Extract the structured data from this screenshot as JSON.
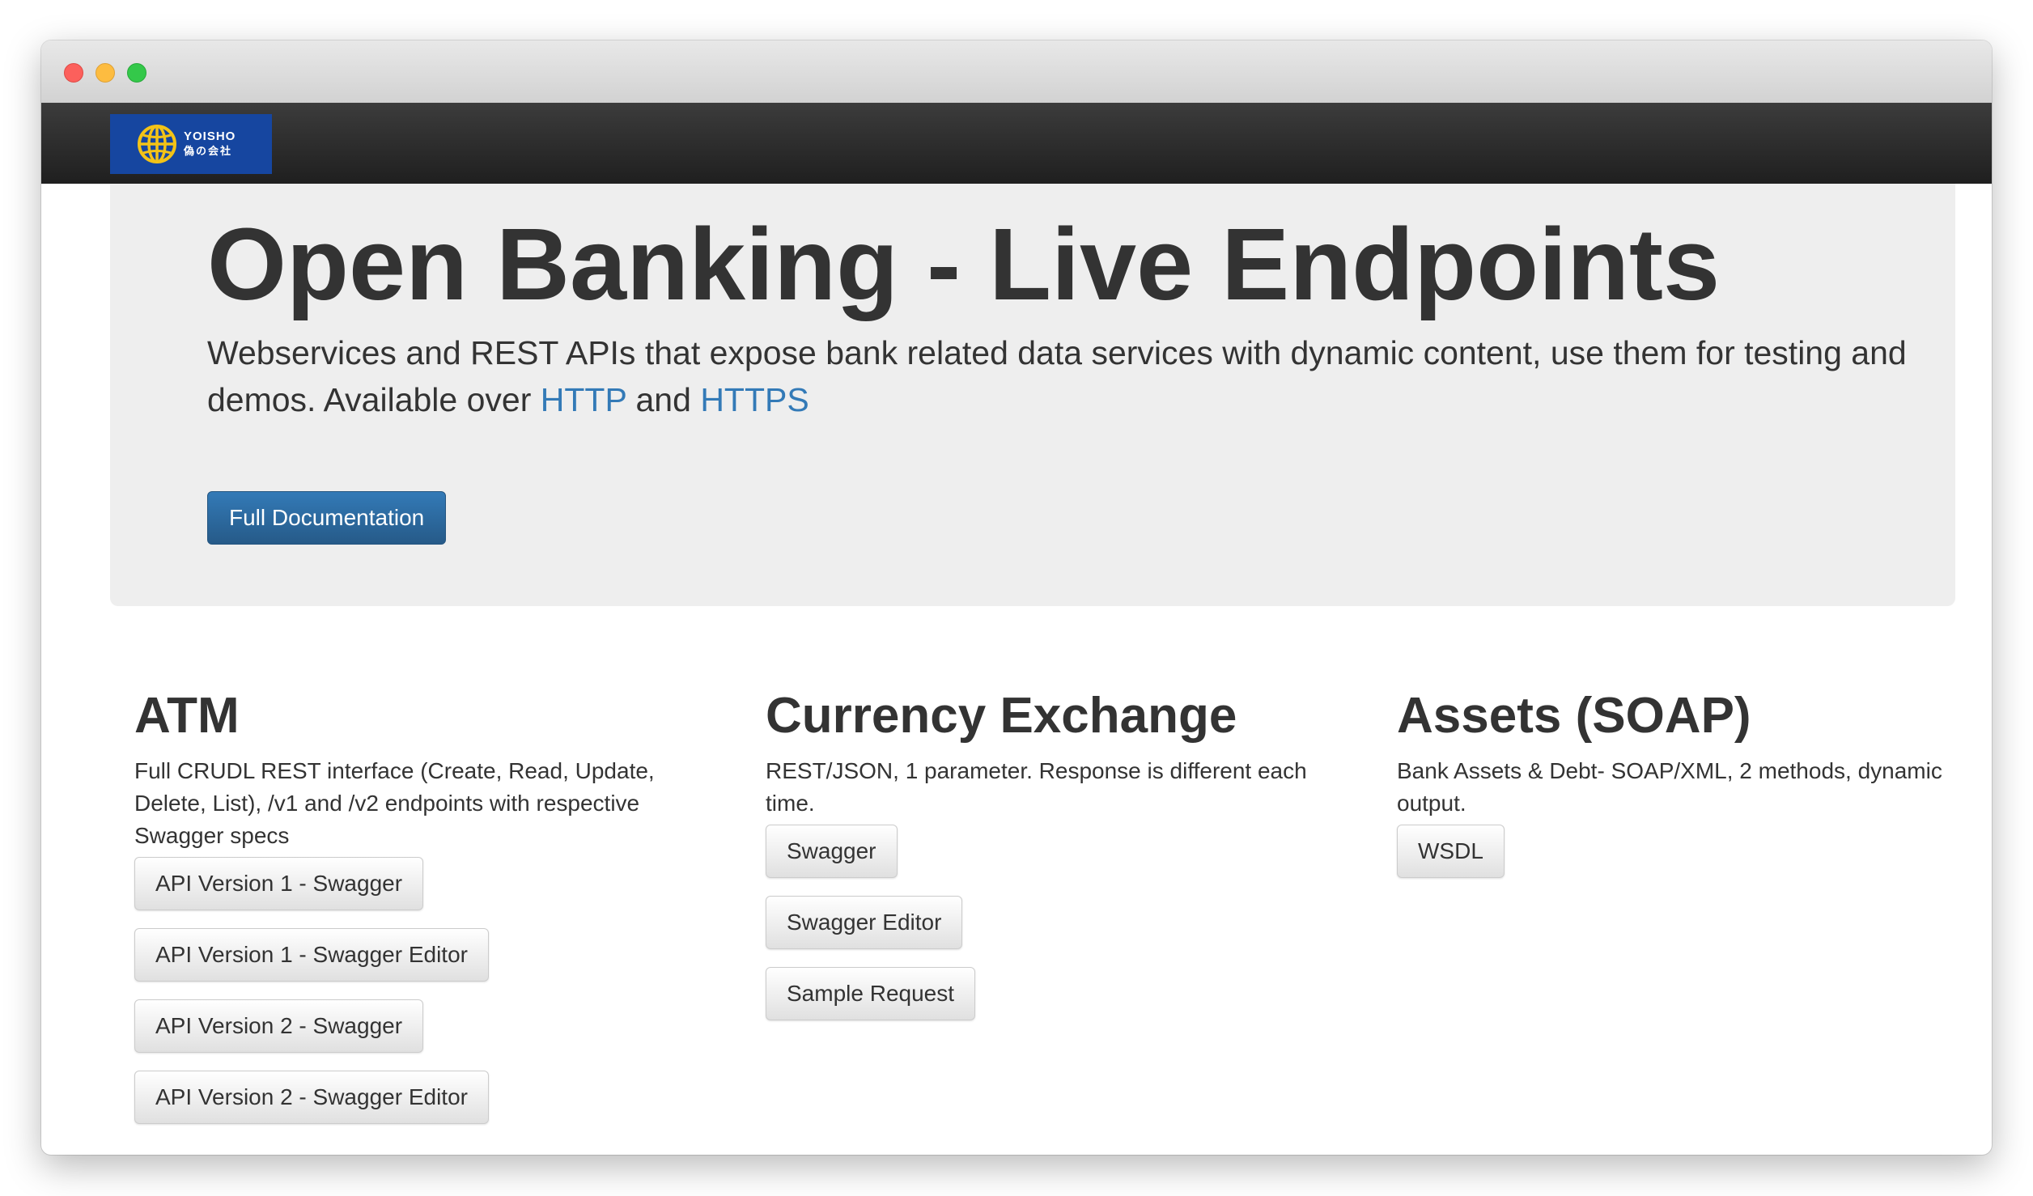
{
  "navbar": {
    "logo_name": "YOISHO",
    "logo_sub": "偽の会社"
  },
  "jumbotron": {
    "title": "Open Banking - Live Endpoints",
    "lead_text": "Webservices and REST APIs that expose bank related data services with dynamic content, use them for testing and demos. Available over",
    "link_http": "HTTP",
    "and_word": "and",
    "link_https": "HTTPS",
    "button_label": "Full Documentation"
  },
  "sections": {
    "atm": {
      "title": "ATM",
      "description": "Full CRUDL REST interface (Create, Read, Update, Delete, List), /v1 and /v2 endpoints with respective Swagger specs",
      "buttons": [
        "API Version 1 - Swagger",
        "API Version 1 - Swagger Editor",
        "API Version 2 - Swagger",
        "API Version 2 - Swagger Editor"
      ]
    },
    "currency": {
      "title": "Currency Exchange",
      "description": "REST/JSON, 1 parameter. Response is different each time.",
      "buttons": [
        "Swagger",
        "Swagger Editor",
        "Sample Request"
      ]
    },
    "assets": {
      "title": "Assets (SOAP)",
      "description": "Bank Assets & Debt- SOAP/XML, 2 methods, dynamic output.",
      "buttons": [
        "WSDL"
      ]
    }
  },
  "colors": {
    "navbar": "#222222",
    "jumbotron_bg": "#eeeeee",
    "link": "#337ab7",
    "primary_button": "#2e6da4",
    "logo_bg": "#1646a0",
    "logo_globe": "#f3c317"
  },
  "icons": {
    "logo": "globe-icon"
  }
}
